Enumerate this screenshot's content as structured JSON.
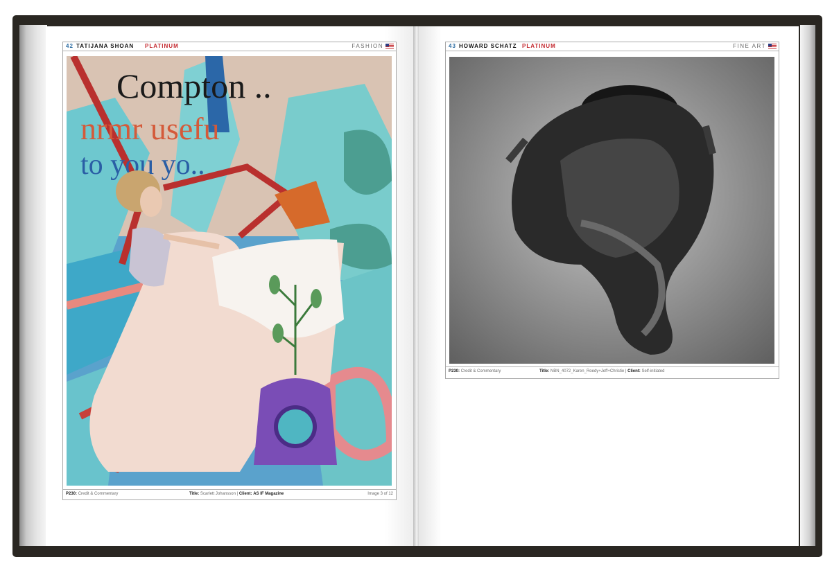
{
  "left_page": {
    "header": {
      "page_number": "42",
      "artist": "TATIJANA SHOAN",
      "award": "PLATINUM",
      "category": "FASHION"
    },
    "image": {
      "description_icon": "collage-artwork-image",
      "overlay_text": {
        "line1": "Compton ..",
        "line2": "nrmr  usefu",
        "line3": "to you yo.."
      }
    },
    "footer": {
      "code_label": "P230:",
      "code_text": "Credit & Commentary",
      "title_label": "Title:",
      "title_value": "Scarlett Johansson",
      "separator": "|",
      "client_label": "Client:",
      "client_value": "AS IF Magazine",
      "image_count": "Image 3 of 12"
    }
  },
  "right_page": {
    "header": {
      "page_number": "43",
      "artist": "HOWARD SCHATZ",
      "award": "PLATINUM",
      "category": "FINE ART"
    },
    "image": {
      "description_icon": "bw-figure-photo"
    },
    "footer": {
      "code_label": "P230:",
      "code_text": "Credit & Commentary",
      "title_label": "Title:",
      "title_value": "NBN_4072_Karen_Roedy+Jeff+Christie",
      "separator": "|",
      "client_label": "Client:",
      "client_value": "Self-initiated"
    }
  },
  "colors": {
    "accent_blue": "#2f6ea3",
    "accent_red": "#c3272d",
    "cover": "#2a2722"
  }
}
